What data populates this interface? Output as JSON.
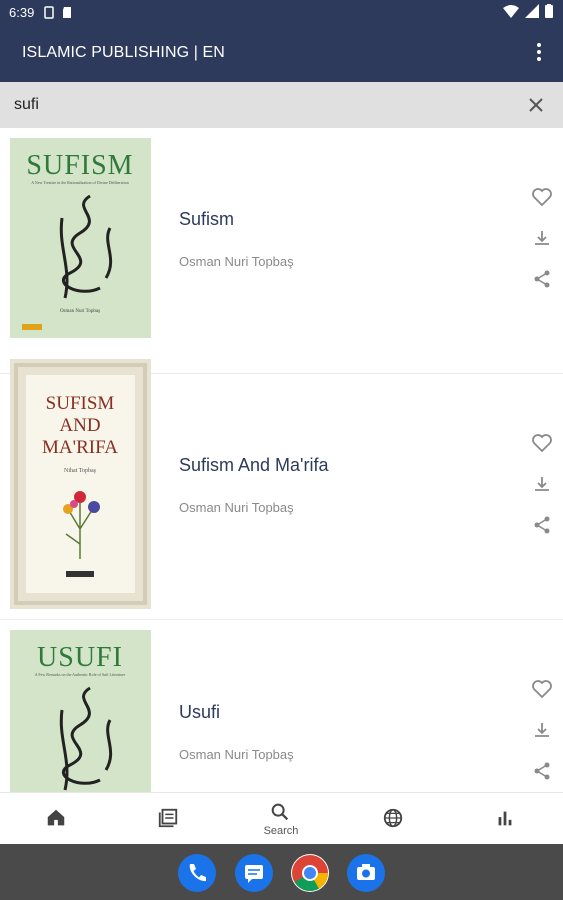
{
  "status": {
    "time": "6:39"
  },
  "app_bar": {
    "title": "ISLAMIC PUBLISHING | EN"
  },
  "search": {
    "value": "sufi"
  },
  "books": [
    {
      "title": "Sufism",
      "author": "Osman Nuri Topbaş",
      "cover": {
        "heading": "SUFISM",
        "subtitle": "A New Treatise in the Rationalization of Divine Deliberation",
        "author": "Osman Nuri Topbaş",
        "color": "#cfe0c4",
        "heading_color": "#2f7a3a"
      }
    },
    {
      "title": "Sufism And Ma'rifa",
      "author": "Osman Nuri Topbaş",
      "cover": {
        "heading_line1": "SUFISM",
        "heading_line2": "AND",
        "heading_line3": "MA'RIFA",
        "author": "Nihat Topbaş",
        "color": "#f3eede",
        "heading_color": "#8a2e22"
      }
    },
    {
      "title": "Usufi",
      "author": "Osman Nuri Topbaş",
      "cover": {
        "heading": "USUFI",
        "subtitle": "A Few Remarks on the Authentic Role of Sufi Literature",
        "color": "#cfe0c4",
        "heading_color": "#2f7a3a"
      }
    }
  ],
  "bottom_nav": [
    {
      "id": "home",
      "icon": "home-icon",
      "label": ""
    },
    {
      "id": "library",
      "icon": "library-icon",
      "label": ""
    },
    {
      "id": "search",
      "icon": "search-icon",
      "label": "Search",
      "active": true
    },
    {
      "id": "language",
      "icon": "globe-icon",
      "label": ""
    },
    {
      "id": "stats",
      "icon": "bar-chart-icon",
      "label": ""
    }
  ],
  "dock": [
    {
      "icon": "phone-app-icon",
      "color": "#1a73e8"
    },
    {
      "icon": "messages-app-icon",
      "color": "#1a73e8"
    },
    {
      "icon": "chrome-app-icon",
      "color": "#ffffff"
    },
    {
      "icon": "camera-app-icon",
      "color": "#1a73e8"
    }
  ],
  "colors": {
    "primary": "#2d3a5c",
    "search_bg": "#e0e0e0",
    "icon_gray": "#8a8a8a"
  }
}
